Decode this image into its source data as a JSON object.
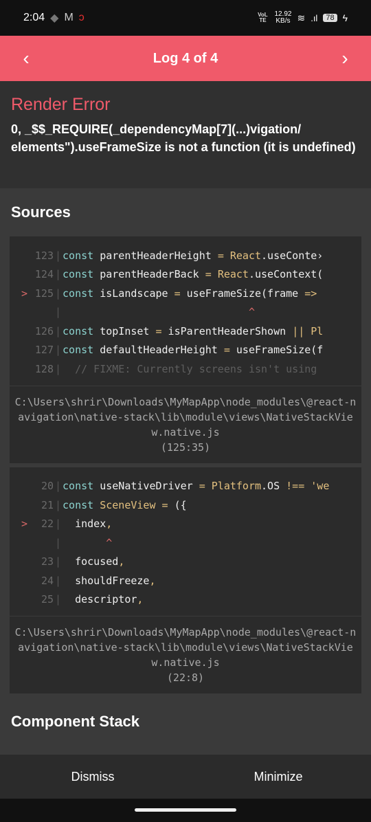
{
  "status_bar": {
    "time": "2:04",
    "network_speed": "12.92",
    "network_unit": "KB/s",
    "volte": "VoLTE",
    "battery": "78"
  },
  "header": {
    "title": "Log 4 of 4",
    "prev_icon": "chevron-left",
    "next_icon": "chevron-right",
    "color": "#f05a6a"
  },
  "error": {
    "title": "Render Error",
    "message": "0, _$$_REQUIRE(_dependencyMap[7](...)vigation/ elements\").useFrameSize is not a function (it is undefined)"
  },
  "sources": {
    "title": "Sources",
    "blocks": [
      {
        "lines": [
          {
            "marker": "",
            "num": "123",
            "tokens": [
              [
                "kw",
                "const"
              ],
              [
                "tx",
                " parentHeaderHeight "
              ],
              [
                "op",
                "="
              ],
              [
                "tx",
                " "
              ],
              [
                "ty",
                "React"
              ],
              [
                "tx",
                ".useConte›"
              ]
            ]
          },
          {
            "marker": "",
            "num": "124",
            "tokens": [
              [
                "kw",
                "const"
              ],
              [
                "tx",
                " parentHeaderBack "
              ],
              [
                "op",
                "="
              ],
              [
                "tx",
                " "
              ],
              [
                "ty",
                "React"
              ],
              [
                "tx",
                ".useContext("
              ]
            ]
          },
          {
            "marker": ">",
            "num": "125",
            "tokens": [
              [
                "kw",
                "const"
              ],
              [
                "tx",
                " isLandscape "
              ],
              [
                "op",
                "="
              ],
              [
                "tx",
                " useFrameSize(frame "
              ],
              [
                "op",
                "=>"
              ]
            ]
          },
          {
            "marker": "",
            "num": "",
            "tokens": [
              [
                "ca",
                "                              ^"
              ]
            ]
          },
          {
            "marker": "",
            "num": "126",
            "tokens": [
              [
                "kw",
                "const"
              ],
              [
                "tx",
                " topInset "
              ],
              [
                "op",
                "="
              ],
              [
                "tx",
                " isParentHeaderShown "
              ],
              [
                "op",
                "||"
              ],
              [
                "ty",
                " Pl"
              ]
            ]
          },
          {
            "marker": "",
            "num": "127",
            "tokens": [
              [
                "kw",
                "const"
              ],
              [
                "tx",
                " defaultHeaderHeight "
              ],
              [
                "op",
                "="
              ],
              [
                "tx",
                " useFrameSize(f"
              ]
            ]
          },
          {
            "marker": "",
            "num": "128",
            "tokens": [
              [
                "cm",
                "  // FIXME: Currently screens isn't using"
              ]
            ]
          }
        ],
        "path": "C:\\Users\\shrir\\Downloads\\MyMapApp\\node_modules\\@react-navigation\\native-stack\\lib\\module\\views\\NativeStackView.native.js",
        "location": "(125:35)"
      },
      {
        "lines": [
          {
            "marker": "",
            "num": "20",
            "tokens": [
              [
                "kw",
                "const"
              ],
              [
                "tx",
                " useNativeDriver "
              ],
              [
                "op",
                "="
              ],
              [
                "ty",
                " Platform"
              ],
              [
                "tx",
                ".OS "
              ],
              [
                "op",
                "!=="
              ],
              [
                "ty",
                " 'we"
              ]
            ]
          },
          {
            "marker": "",
            "num": "21",
            "tokens": [
              [
                "kw",
                "const"
              ],
              [
                "ty",
                " SceneView"
              ],
              [
                "tx",
                " "
              ],
              [
                "op",
                "="
              ],
              [
                "tx",
                " ({"
              ]
            ]
          },
          {
            "marker": ">",
            "num": "22",
            "tokens": [
              [
                "tx",
                "  index"
              ],
              [
                "op",
                ","
              ]
            ]
          },
          {
            "marker": "",
            "num": "",
            "tokens": [
              [
                "ca",
                "       ^"
              ]
            ]
          },
          {
            "marker": "",
            "num": "23",
            "tokens": [
              [
                "tx",
                "  focused"
              ],
              [
                "op",
                ","
              ]
            ]
          },
          {
            "marker": "",
            "num": "24",
            "tokens": [
              [
                "tx",
                "  shouldFreeze"
              ],
              [
                "op",
                ","
              ]
            ]
          },
          {
            "marker": "",
            "num": "25",
            "tokens": [
              [
                "tx",
                "  descriptor"
              ],
              [
                "op",
                ","
              ]
            ]
          }
        ],
        "path": "C:\\Users\\shrir\\Downloads\\MyMapApp\\node_modules\\@react-navigation\\native-stack\\lib\\module\\views\\NativeStackView.native.js",
        "location": "(22:8)"
      }
    ]
  },
  "component_stack": {
    "title": "Component Stack"
  },
  "footer": {
    "dismiss": "Dismiss",
    "minimize": "Minimize"
  }
}
